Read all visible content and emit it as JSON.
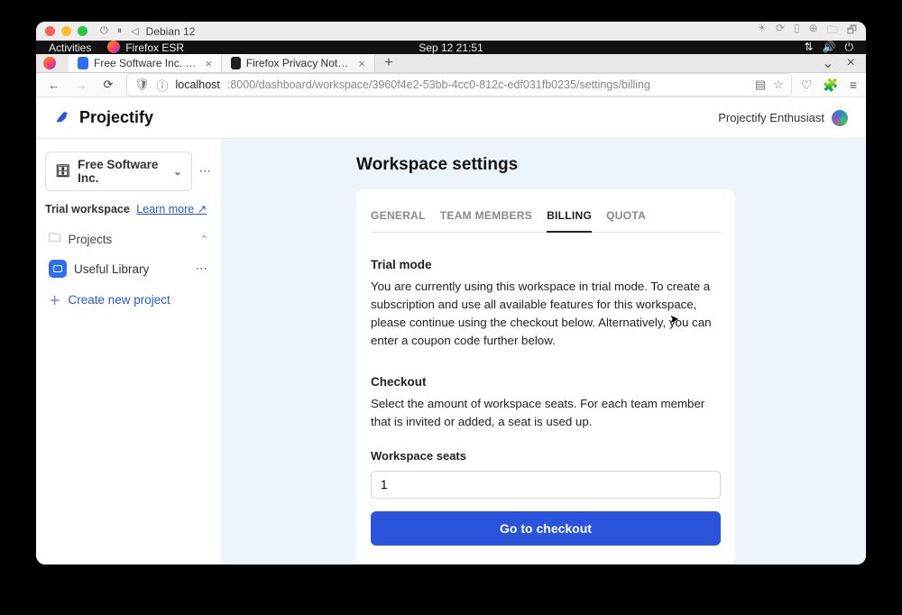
{
  "os_titlebar": {
    "distro": "Debian 12"
  },
  "gnome": {
    "activities": "Activities",
    "app": "Firefox ESR",
    "clock": "Sep 12  21:51"
  },
  "browser": {
    "tabs": [
      {
        "title": "Free Software Inc. billing",
        "active": true
      },
      {
        "title": "Firefox Privacy Notice — …",
        "active": false
      }
    ],
    "url_host": "localhost",
    "url_path": ":8000/dashboard/workspace/3960f4e2-53bb-4cc0-812c-edf031fb0235/settings/billing"
  },
  "app": {
    "brand": "Projectify",
    "user_label": "Projectify Enthusiast"
  },
  "sidebar": {
    "workspace_name": "Free Software Inc.",
    "trial_label": "Trial workspace",
    "learn_more": "Learn more",
    "projects_label": "Projects",
    "projects": [
      {
        "name": "Useful Library"
      }
    ],
    "create_label": "Create new project"
  },
  "settings": {
    "title": "Workspace settings",
    "tabs": {
      "general": "GENERAL",
      "team": "TEAM MEMBERS",
      "billing": "BILLING",
      "quota": "QUOTA"
    },
    "trial": {
      "heading": "Trial mode",
      "body": "You are currently using this workspace in trial mode. To create a subscription and use all available features for this workspace, please continue using the checkout below. Alternatively, you can enter a coupon code further below."
    },
    "checkout": {
      "heading": "Checkout",
      "body": "Select the amount of workspace seats. For each team member that is invited or added, a seat is used up.",
      "seats_label": "Workspace seats",
      "seats_value": "1",
      "cta": "Go to checkout"
    }
  }
}
